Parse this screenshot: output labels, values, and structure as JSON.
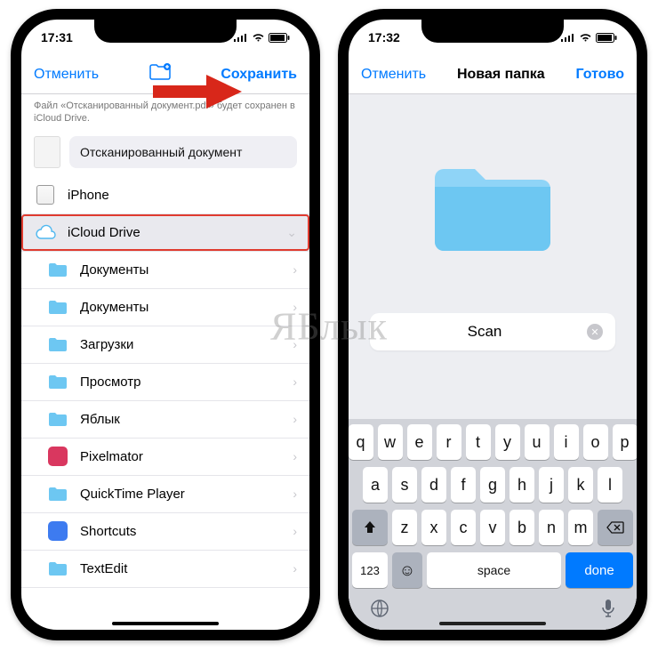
{
  "watermark": "ЯБлык",
  "left": {
    "status_time": "17:31",
    "nav": {
      "cancel": "Отменить",
      "save": "Сохранить"
    },
    "subtext": "Файл «Отсканированный документ.pdf» будет сохранен в iCloud Drive.",
    "doc_chip": "Отсканированный документ",
    "locations": {
      "iphone": "iPhone",
      "icloud": "iCloud Drive"
    },
    "folders": [
      {
        "label": "Документы",
        "chevron": true,
        "type": "folder"
      },
      {
        "label": "Документы",
        "chevron": true,
        "type": "folder"
      },
      {
        "label": "Загрузки",
        "chevron": true,
        "type": "folder"
      },
      {
        "label": "Просмотр",
        "chevron": true,
        "type": "folder"
      },
      {
        "label": "Яблык",
        "chevron": true,
        "type": "folder"
      },
      {
        "label": "Pixelmator",
        "chevron": true,
        "type": "app",
        "color": "#d9375f"
      },
      {
        "label": "QuickTime Player",
        "chevron": true,
        "type": "folder"
      },
      {
        "label": "Shortcuts",
        "chevron": true,
        "type": "app",
        "color": "#3d7bf0"
      },
      {
        "label": "TextEdit",
        "chevron": true,
        "type": "folder"
      }
    ]
  },
  "right": {
    "status_time": "17:32",
    "nav": {
      "cancel": "Отменить",
      "title": "Новая папка",
      "done": "Готово"
    },
    "folder_name": "Scan",
    "keyboard": {
      "row1": [
        "q",
        "w",
        "e",
        "r",
        "t",
        "y",
        "u",
        "i",
        "o",
        "p"
      ],
      "row2": [
        "a",
        "s",
        "d",
        "f",
        "g",
        "h",
        "j",
        "k",
        "l"
      ],
      "row3": [
        "z",
        "x",
        "c",
        "v",
        "b",
        "n",
        "m"
      ],
      "num": "123",
      "space": "space",
      "done": "done"
    }
  },
  "colors": {
    "accent": "#007aff",
    "highlight": "#e03b2f",
    "folder": "#6dc7f2"
  }
}
